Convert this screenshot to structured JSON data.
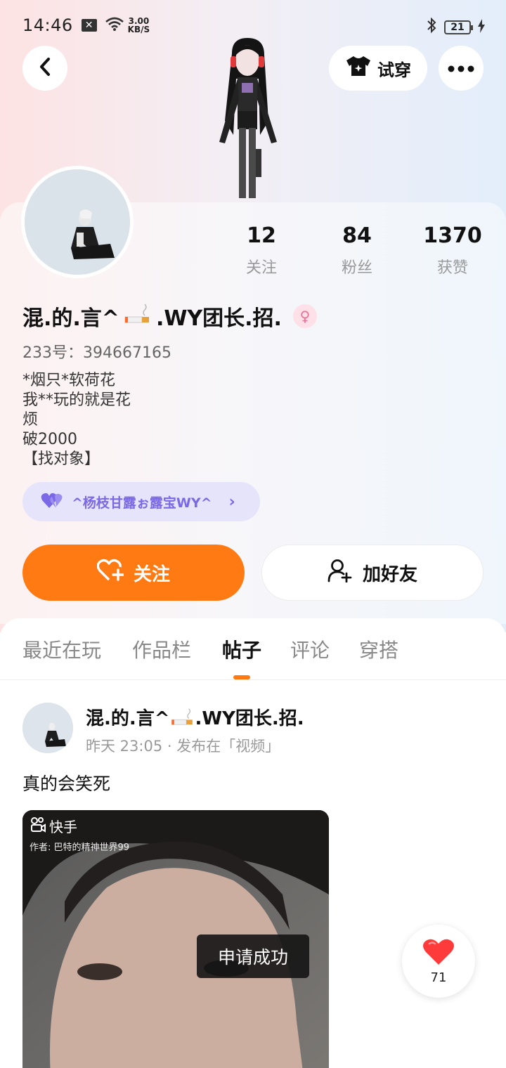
{
  "status_bar": {
    "time": "14:46",
    "net_speed_value": "3.00",
    "net_speed_unit": "KB/S",
    "battery": "21"
  },
  "header": {
    "try_on_label": "试穿"
  },
  "profile": {
    "stats": [
      {
        "value": "12",
        "label": "关注"
      },
      {
        "value": "84",
        "label": "粉丝"
      },
      {
        "value": "1370",
        "label": "获赞"
      }
    ],
    "username_part1": "混.的.言^",
    "username_part2": ".WY团长.招.",
    "gender_symbol": "♀",
    "id_line": "233号：394667165",
    "bio_lines": [
      "*烟只*软荷花",
      "我**玩的就是花",
      "烦",
      "破2000",
      "【找对象】"
    ],
    "intimate_friend": "^杨枝甘露ぉ露宝WY^"
  },
  "actions": {
    "follow_label": "关注",
    "add_friend_label": "加好友"
  },
  "tabs": [
    {
      "label": "最近在玩",
      "active": false
    },
    {
      "label": "作品栏",
      "active": false
    },
    {
      "label": "帖子",
      "active": true
    },
    {
      "label": "评论",
      "active": false
    },
    {
      "label": "穿搭",
      "active": false
    }
  ],
  "post": {
    "author_part1": "混.的.言^",
    "author_part2": ".WY团长.招.",
    "meta": "昨天 23:05 · 发布在「视频」",
    "text": "真的会笑死",
    "video_watermark": "快手",
    "video_author": "作者: 巴特的精神世界99",
    "like_count": "71"
  },
  "toast": "申请成功",
  "colors": {
    "accent_orange": "#ff7a12",
    "chip_purple": "#7a68e6",
    "gender_pink": "#f06f96",
    "like_red": "#ff3a3a"
  }
}
